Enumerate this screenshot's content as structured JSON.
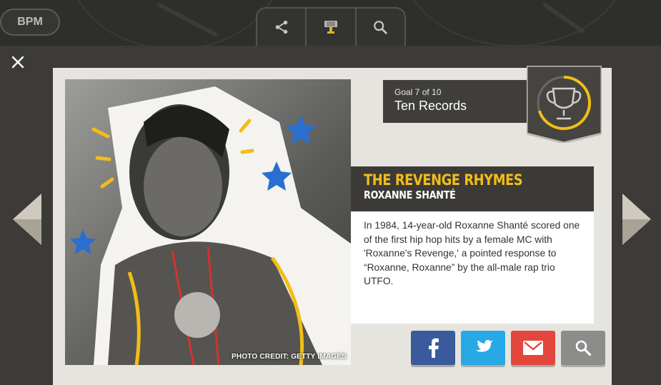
{
  "topbar": {
    "bpm_label": "BPM",
    "icons": [
      "share-icon",
      "trophy-icon",
      "search-icon"
    ]
  },
  "modal": {
    "close_icon": "close-icon",
    "prev_icon": "arrow-left-icon",
    "next_icon": "arrow-right-icon"
  },
  "goal": {
    "progress_label": "Goal 7 of 10",
    "title": "Ten Records",
    "badge_icon": "trophy-icon",
    "progress_fraction": 0.7
  },
  "photo": {
    "credit": "PHOTO CREDIT: GETTY IMAGES"
  },
  "story": {
    "title": "THE REVENGE RHYMES",
    "artist": "ROXANNE SHANTÉ",
    "body": "In 1984, 14-year-old Roxanne Shanté scored one of the first hip hop hits by a female MC with 'Roxanne's Revenge,' a pointed response to “Roxanne, Roxanne” by the all-male rap trio UTFO."
  },
  "share_buttons": [
    {
      "icon": "facebook-icon",
      "color": "#3a5a9c"
    },
    {
      "icon": "twitter-icon",
      "color": "#27a9e6"
    },
    {
      "icon": "email-icon",
      "color": "#e3463c"
    },
    {
      "icon": "search-icon",
      "color": "#8c8c8a"
    }
  ],
  "colors": {
    "accent_yellow": "#f2bd17",
    "dark_panel": "#3b3a37",
    "panel_bg": "#e6e4df"
  }
}
